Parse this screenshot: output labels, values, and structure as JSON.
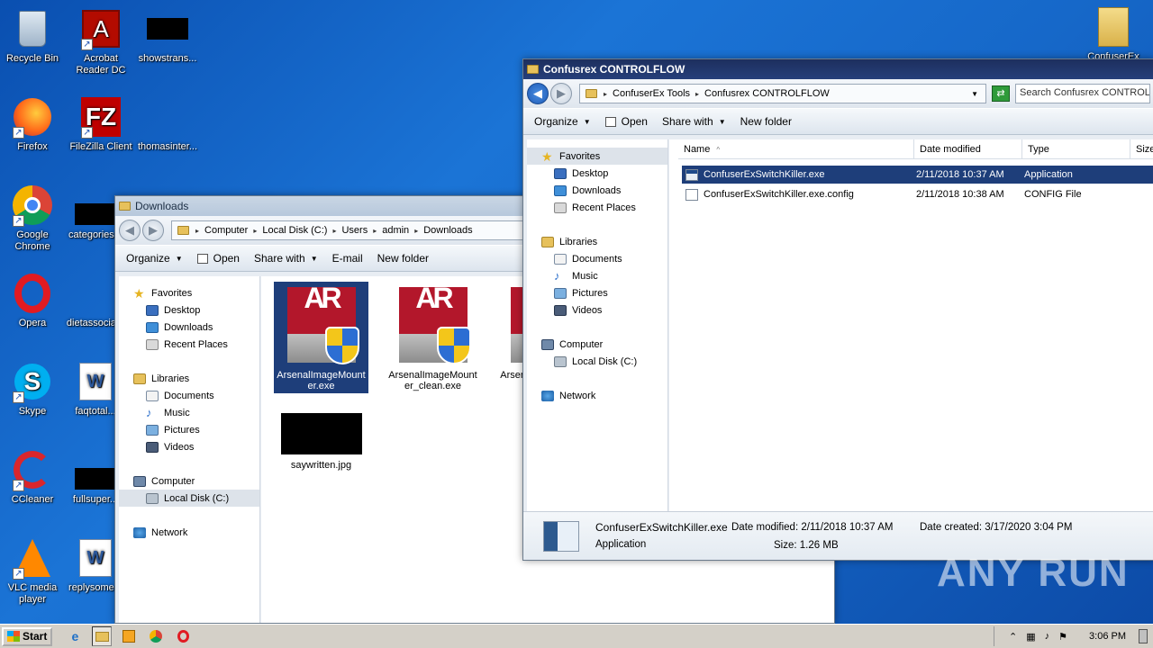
{
  "desktop": {
    "icons": [
      {
        "label": "Recycle Bin",
        "icon": "recycle-bin-icon"
      },
      {
        "label": "Acrobat Reader DC",
        "icon": "acrobat-icon"
      },
      {
        "label": "showstrans...",
        "icon": "redacted-file-icon"
      },
      {
        "label": "Firefox",
        "icon": "firefox-icon"
      },
      {
        "label": "FileZilla Client",
        "icon": "filezilla-icon"
      },
      {
        "label": "thomasinter...",
        "icon": "file-icon"
      },
      {
        "label": "Google Chrome",
        "icon": "chrome-icon"
      },
      {
        "label": "categories...",
        "icon": "redacted-file-icon"
      },
      {
        "label": "Opera",
        "icon": "opera-icon"
      },
      {
        "label": "dietassocia...",
        "icon": "file-icon"
      },
      {
        "label": "Skype",
        "icon": "skype-icon"
      },
      {
        "label": "faqtotal...",
        "icon": "word-doc-icon"
      },
      {
        "label": "CCleaner",
        "icon": "ccleaner-icon"
      },
      {
        "label": "fullsuper...",
        "icon": "redacted-file-icon"
      },
      {
        "label": "VLC media player",
        "icon": "vlc-icon"
      },
      {
        "label": "replysome...",
        "icon": "word-doc-icon"
      }
    ],
    "top_right_folder": "ConfuserEx"
  },
  "downloads_window": {
    "title": "Downloads",
    "breadcrumb": [
      "Computer",
      "Local Disk (C:)",
      "Users",
      "admin",
      "Downloads"
    ],
    "toolbar": {
      "organize": "Organize",
      "open": "Open",
      "share_with": "Share with",
      "email": "E-mail",
      "new_folder": "New folder"
    },
    "nav": {
      "favorites": "Favorites",
      "desktop": "Desktop",
      "downloads": "Downloads",
      "recent": "Recent Places",
      "libraries": "Libraries",
      "documents": "Documents",
      "music": "Music",
      "pictures": "Pictures",
      "videos": "Videos",
      "computer": "Computer",
      "local_disk": "Local Disk (C:)",
      "network": "Network"
    },
    "files": [
      {
        "name": "ArsenalImageMounter.exe"
      },
      {
        "name": "ArsenalImageMounter_clean.exe"
      },
      {
        "name": "ArsenalImageMounter_c..."
      },
      {
        "name": "saywritten.jpg"
      }
    ]
  },
  "confuser_window": {
    "title": "Confusrex CONTROLFLOW",
    "breadcrumb": [
      "ConfuserEx Tools",
      "Confusrex CONTROLFLOW"
    ],
    "search_placeholder": "Search Confusrex CONTROLFLOW",
    "toolbar": {
      "organize": "Organize",
      "open": "Open",
      "share_with": "Share with",
      "new_folder": "New folder"
    },
    "nav": {
      "favorites": "Favorites",
      "desktop": "Desktop",
      "downloads": "Downloads",
      "recent": "Recent Places",
      "libraries": "Libraries",
      "documents": "Documents",
      "music": "Music",
      "pictures": "Pictures",
      "videos": "Videos",
      "computer": "Computer",
      "local_disk": "Local Disk (C:)",
      "network": "Network"
    },
    "columns": {
      "name": "Name",
      "date": "Date modified",
      "type": "Type",
      "size": "Size"
    },
    "rows": [
      {
        "name": "ConfuserExSwitchKiller.exe",
        "date": "2/11/2018 10:37 AM",
        "type": "Application"
      },
      {
        "name": "ConfuserExSwitchKiller.exe.config",
        "date": "2/11/2018 10:38 AM",
        "type": "CONFIG File"
      }
    ],
    "details": {
      "filename": "ConfuserExSwitchKiller.exe",
      "filetype": "Application",
      "modified_label": "Date modified:",
      "modified": "2/11/2018 10:37 AM",
      "size_label": "Size:",
      "size": "1.26 MB",
      "created_label": "Date created:",
      "created": "3/17/2020 3:04 PM"
    }
  },
  "taskbar": {
    "start": "Start",
    "clock": "3:06 PM"
  },
  "watermark": "ANY RUN"
}
